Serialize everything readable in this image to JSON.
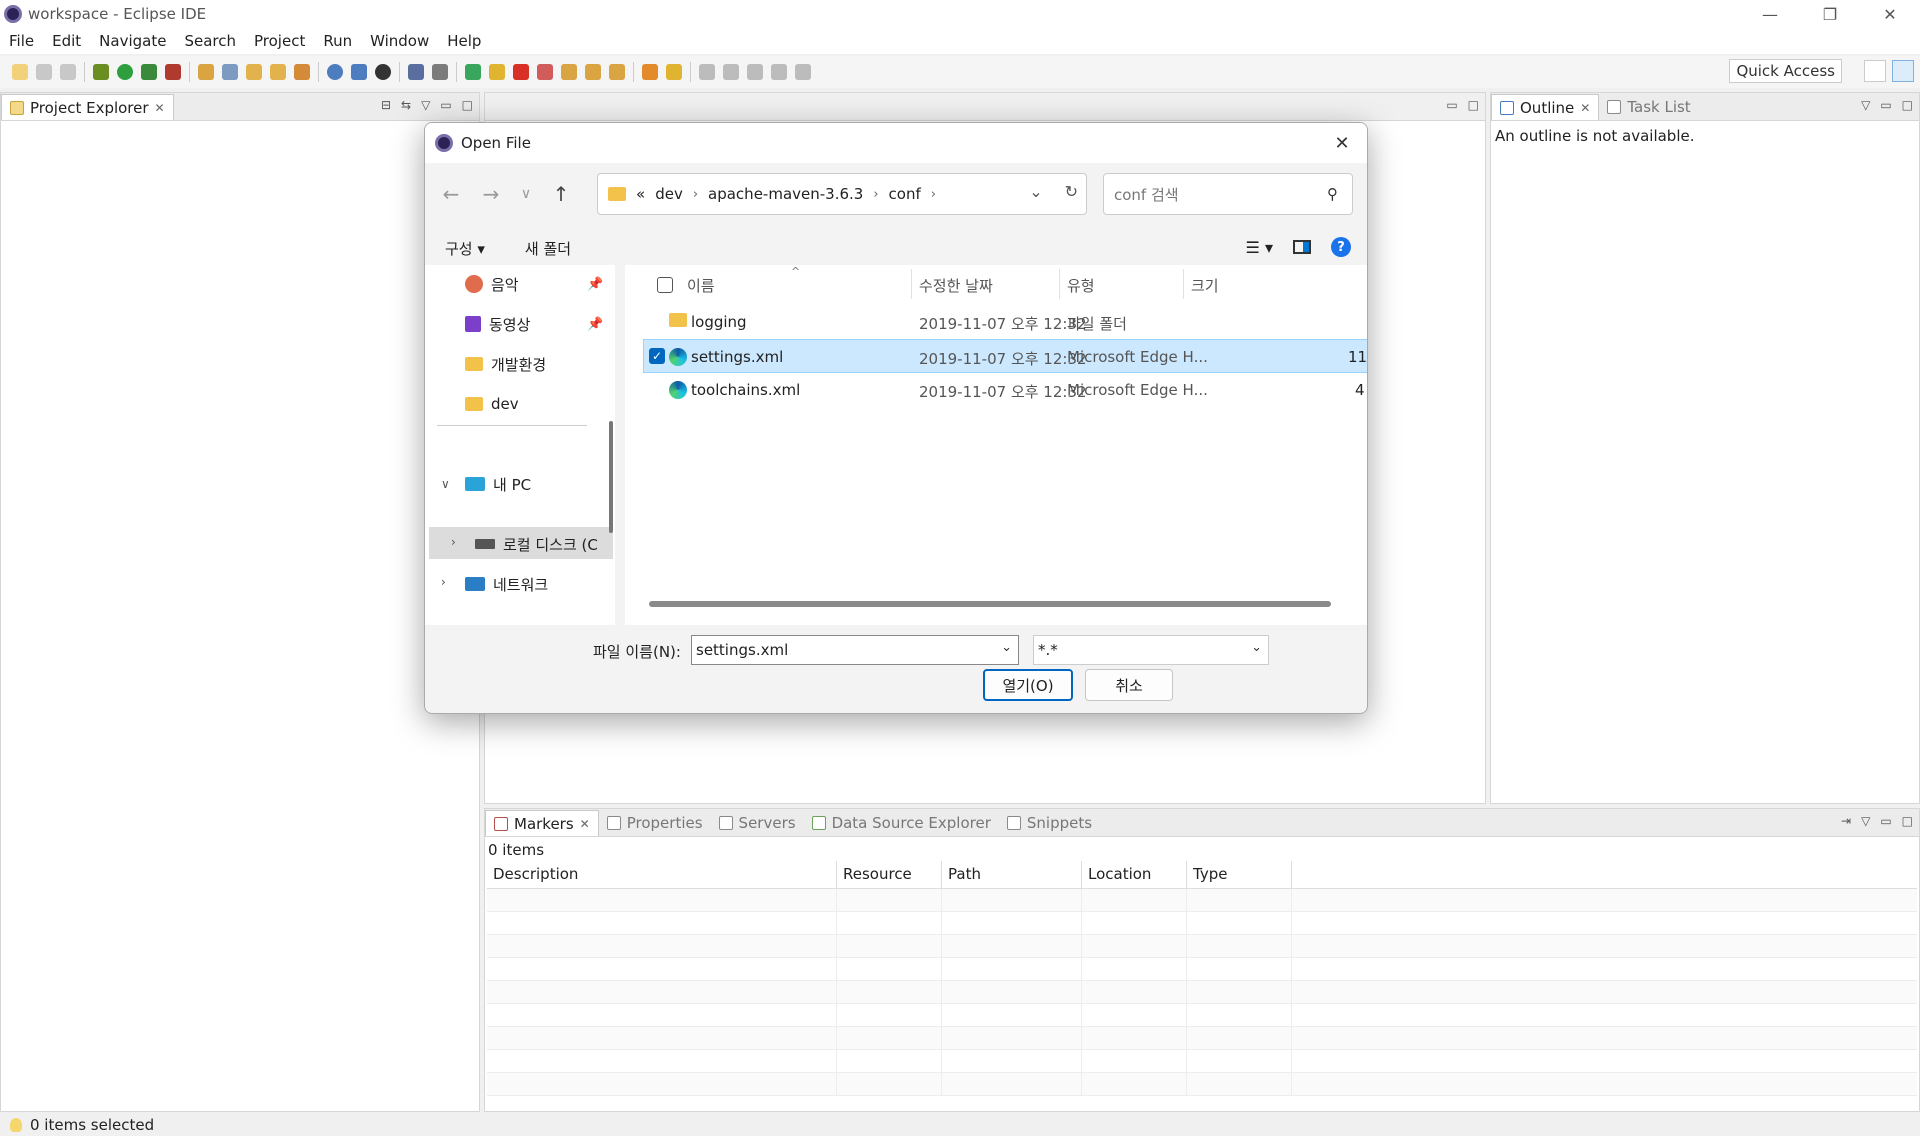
{
  "window": {
    "title": "workspace - Eclipse IDE",
    "minimize": "—",
    "restore": "❐",
    "close": "✕"
  },
  "menu": [
    "File",
    "Edit",
    "Navigate",
    "Search",
    "Project",
    "Run",
    "Window",
    "Help"
  ],
  "toolbar": {
    "quick_access": "Quick Access"
  },
  "project_explorer": {
    "tab_label": "Project Explorer",
    "close": "✕"
  },
  "outline": {
    "tab_label": "Outline",
    "close": "✕",
    "task_tab": "Task List",
    "message": "An outline is not available."
  },
  "markers": {
    "tabs": [
      "Markers",
      "Properties",
      "Servers",
      "Data Source Explorer",
      "Snippets"
    ],
    "close": "✕",
    "items_count": "0 items",
    "columns": [
      "Description",
      "Resource",
      "Path",
      "Location",
      "Type"
    ]
  },
  "statusbar": {
    "text": "0 items selected"
  },
  "dialog": {
    "title": "Open File",
    "close": "✕",
    "breadcrumb": [
      "«",
      "dev",
      "apache-maven-3.6.3",
      "conf"
    ],
    "crumb_sep": "›",
    "search_placeholder": "conf 검색",
    "organize": "구성 ▾",
    "new_folder": "새 폴더",
    "help": "?",
    "nav": [
      {
        "label": "음악",
        "icon": "music-icon",
        "pinned": true
      },
      {
        "label": "동영상",
        "icon": "video-icon",
        "pinned": true
      },
      {
        "label": "개발환경",
        "icon": "folder-icon",
        "pinned": false
      },
      {
        "label": "dev",
        "icon": "folder-icon",
        "pinned": false
      },
      {
        "label": "내 PC",
        "icon": "pc-icon",
        "expanded": true
      },
      {
        "label": "로컬 디스크 (C",
        "icon": "disk-icon",
        "selected": true
      },
      {
        "label": "네트워크",
        "icon": "network-icon"
      }
    ],
    "columns": {
      "name": "이름",
      "date": "수정한 날짜",
      "type": "유형",
      "size": "크기"
    },
    "files": [
      {
        "name": "logging",
        "date": "2019-11-07 오후 12:32",
        "type": "파일 폴더",
        "size": "",
        "icon": "folder-icon",
        "selected": false
      },
      {
        "name": "settings.xml",
        "date": "2019-11-07 오후 12:32",
        "type": "Microsoft Edge H...",
        "size": "11",
        "icon": "edge-icon",
        "selected": true
      },
      {
        "name": "toolchains.xml",
        "date": "2019-11-07 오후 12:32",
        "type": "Microsoft Edge H...",
        "size": "4",
        "icon": "edge-icon",
        "selected": false
      }
    ],
    "filename_label": "파일 이름(N):",
    "filename_value": "settings.xml",
    "filter_value": "*.*",
    "open_button": "열기(O)",
    "cancel_button": "취소"
  }
}
